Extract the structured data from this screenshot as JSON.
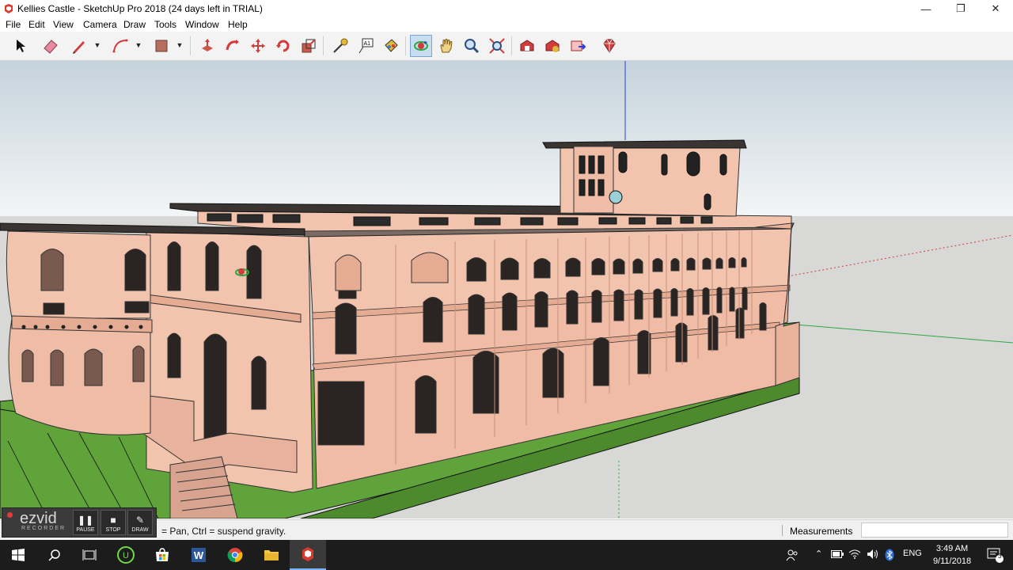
{
  "window": {
    "title": "Kellies Castle - SketchUp Pro 2018 (24 days left in TRIAL)",
    "minimize": "—",
    "maximize": "❐",
    "close": "✕"
  },
  "menu": [
    "File",
    "Edit",
    "View",
    "Camera",
    "Draw",
    "Tools",
    "Window",
    "Help"
  ],
  "toolbar": {
    "tools": [
      {
        "name": "select-tool",
        "icon": "arrow-cursor-icon"
      },
      {
        "name": "eraser-tool",
        "icon": "eraser-icon"
      },
      {
        "name": "line-tool",
        "icon": "pencil-icon"
      },
      {
        "name": "arc-tool",
        "icon": "arc-icon"
      },
      {
        "name": "rectangle-tool",
        "icon": "rectangle-icon"
      },
      {
        "name": "push-pull-tool",
        "icon": "push-pull-icon"
      },
      {
        "name": "follow-me-tool",
        "icon": "follow-me-icon"
      },
      {
        "name": "move-tool",
        "icon": "move-icon"
      },
      {
        "name": "rotate-tool",
        "icon": "rotate-icon"
      },
      {
        "name": "scale-tool",
        "icon": "scale-icon"
      },
      {
        "name": "tape-measure-tool",
        "icon": "tape-measure-icon"
      },
      {
        "name": "text-tool",
        "icon": "text-icon"
      },
      {
        "name": "paint-bucket-tool",
        "icon": "paint-bucket-icon"
      },
      {
        "name": "orbit-tool",
        "icon": "orbit-icon",
        "active": true
      },
      {
        "name": "pan-tool",
        "icon": "hand-icon"
      },
      {
        "name": "zoom-tool",
        "icon": "magnifier-icon"
      },
      {
        "name": "zoom-extents-tool",
        "icon": "zoom-extents-icon"
      },
      {
        "name": "3d-warehouse-tool",
        "icon": "warehouse-icon"
      },
      {
        "name": "extension-warehouse-tool",
        "icon": "extension-icon"
      },
      {
        "name": "layout-send-tool",
        "icon": "send-to-layout-icon"
      },
      {
        "name": "extension-manager-tool",
        "icon": "ruby-gem-icon"
      }
    ],
    "text_icon_label": "A1"
  },
  "status": {
    "hint": "= Pan, Ctrl = suspend gravity.",
    "measurements_label": "Measurements",
    "measurements_value": ""
  },
  "recorder": {
    "logo": "ezvid",
    "sub": "RECORDER",
    "pause": "PAUSE",
    "stop": "STOP",
    "draw": "DRAW"
  },
  "taskbar": {
    "apps": [
      "start-icon",
      "search-icon",
      "task-view-icon",
      "upwork-icon",
      "store-icon",
      "word-icon",
      "chrome-icon",
      "file-explorer-icon",
      "sketchup-icon"
    ],
    "word_letter": "W",
    "upwork_letter": "U",
    "language": "ENG",
    "time": "3:49 AM",
    "date": "9/11/2018",
    "notifications": "3"
  },
  "colors": {
    "facade": "#f2c3ad",
    "facade_dark": "#e6ab93",
    "lawn": "#5fa33a",
    "sky_top": "#c9d6df",
    "ground": "#d9d9d7",
    "axis_red": "#d23c3c",
    "axis_green": "#2aa846",
    "axis_blue": "#2a3fd6"
  }
}
